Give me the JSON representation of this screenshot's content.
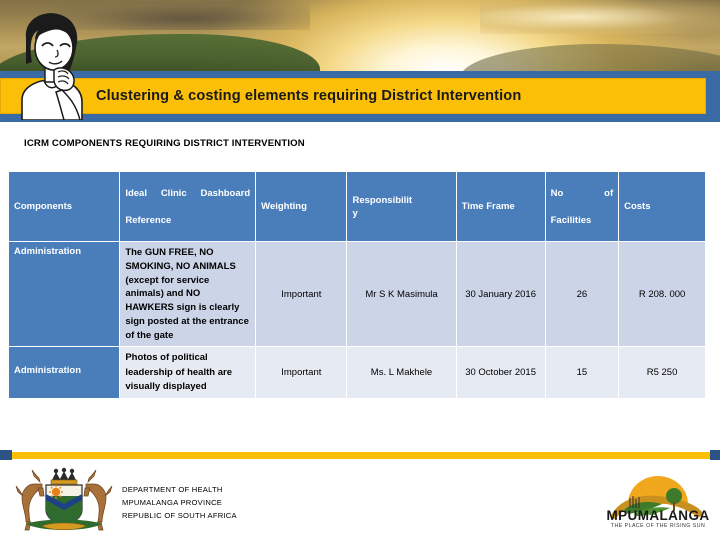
{
  "banner": {
    "title": "Clustering & costing  elements requiring District Intervention",
    "accent_yellow": "#fcbf07",
    "accent_blue": "#3b6ba5"
  },
  "section": {
    "title": "ICRM COMPONENTS REQUIRING DISTRICT INTERVENTION"
  },
  "table": {
    "header_bg": "#4a7ebb",
    "columns": [
      {
        "label": "Components",
        "parts": [
          "Components"
        ]
      },
      {
        "label": "Ideal Clinic Dashboard Reference",
        "line1_a": "Ideal",
        "line1_b": "Clinic",
        "line1_c": "Dashboard",
        "line2": "Reference"
      },
      {
        "label": "Weighting",
        "parts": [
          "Weighting"
        ]
      },
      {
        "label": "Responsibility",
        "line1": "Responsibilit",
        "line2": "y"
      },
      {
        "label": "Time Frame",
        "parts": [
          "Time Frame"
        ]
      },
      {
        "label": "No of Facilities",
        "line1_a": "No",
        "line1_b": "of",
        "line2": "Facilities"
      },
      {
        "label": "Costs",
        "parts": [
          "Costs"
        ]
      }
    ],
    "rows": [
      {
        "component": "Administration",
        "reference": "The GUN FREE, NO SMOKING, NO ANIMALS (except for service animals) and NO HAWKERS  sign is clearly sign posted at the entrance of the gate",
        "weighting": "Important",
        "responsibility": "Mr S K Masimula",
        "time_frame": "30 January 2016",
        "no_of_facilities": "26",
        "costs": "R 208. 000"
      },
      {
        "component": "Administration",
        "reference": "Photos of political leadership of health are visually displayed",
        "weighting": "Important",
        "responsibility": "Ms. L Makhele",
        "time_frame": "30 October 2015",
        "no_of_facilities": "15",
        "costs": "R5  250"
      }
    ]
  },
  "footer": {
    "line1": "DEPARTMENT OF HEALTH",
    "line2": "MPUMALANGA PROVINCE",
    "line3": "REPUBLIC OF SOUTH AFRICA",
    "logo_word": "MPUMALANGA",
    "logo_tagline": "THE PLACE OF THE RISING SUN"
  }
}
